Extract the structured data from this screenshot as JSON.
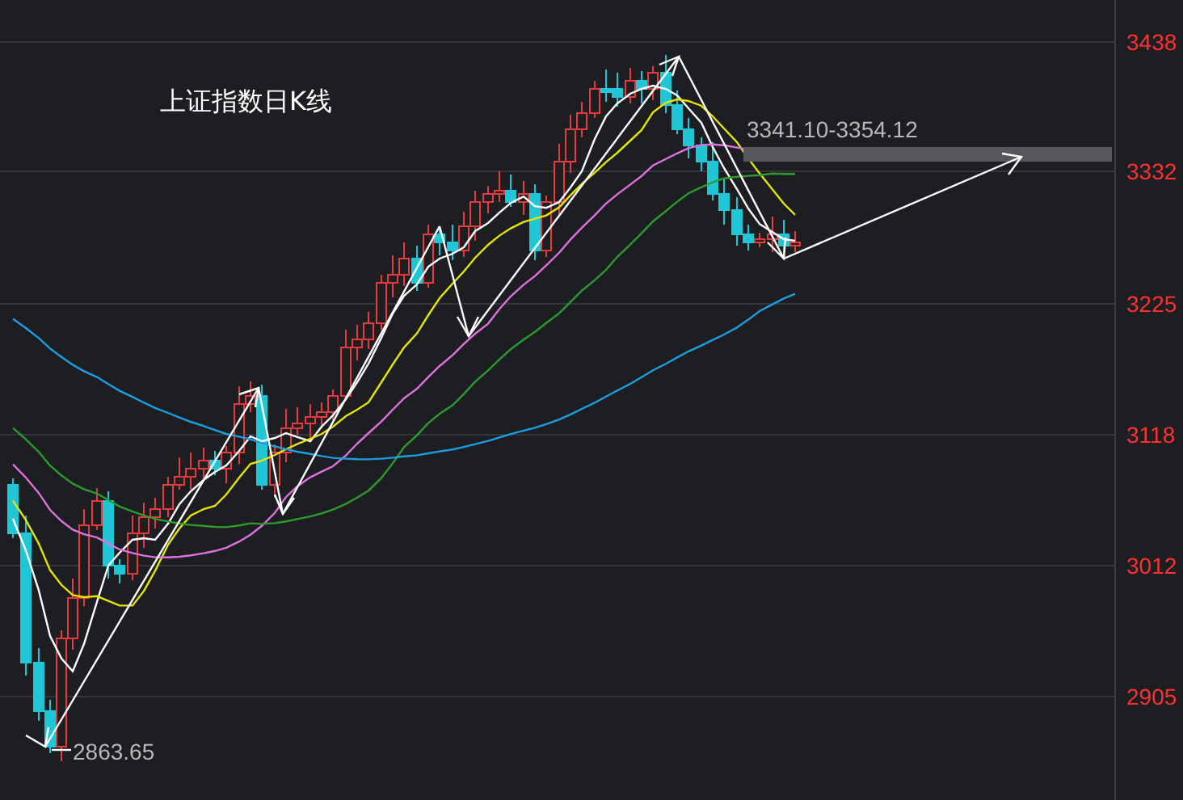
{
  "chart": {
    "title": "上证指数日K线",
    "y_axis_labels": [
      "3438",
      "3332",
      "3225",
      "3118",
      "3012",
      "2905"
    ],
    "range_label": "3341.10-3354.12",
    "low_label": "2863.65"
  }
}
